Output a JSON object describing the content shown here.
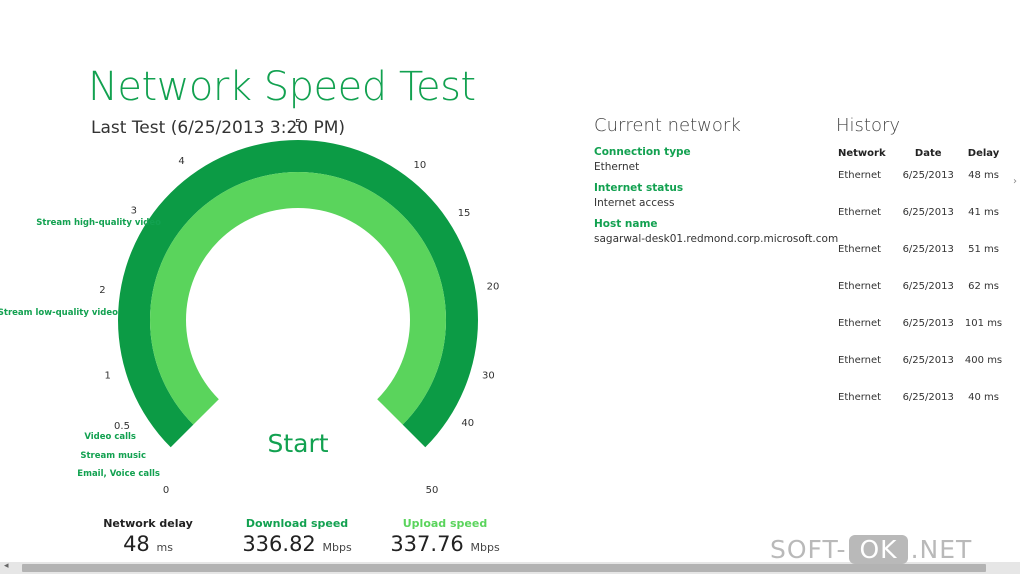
{
  "app": {
    "title": "Network Speed Test",
    "last_test": "Last Test (6/25/2013 3:20 PM)"
  },
  "gauge": {
    "start_label": "Start",
    "ticks": [
      "0",
      "0.5",
      "1",
      "2",
      "3",
      "4",
      "5",
      "10",
      "15",
      "20",
      "30",
      "40",
      "50"
    ],
    "use_labels": [
      "Stream high-quality video",
      "Stream low-quality video",
      "Video calls",
      "Stream music",
      "Email, Voice calls"
    ],
    "colors": {
      "outer": "#0c9b45",
      "inner": "#5ad45c",
      "accent": "#12a150"
    }
  },
  "metrics": [
    {
      "label": "Network delay",
      "value": "48",
      "unit": "ms",
      "color": "#222222"
    },
    {
      "label": "Download speed",
      "value": "336.82",
      "unit": "Mbps",
      "color": "#12a150"
    },
    {
      "label": "Upload speed",
      "value": "337.76",
      "unit": "Mbps",
      "color": "#5ad45c"
    }
  ],
  "current_network": {
    "title": "Current network",
    "items": [
      {
        "label": "Connection type",
        "value": "Ethernet"
      },
      {
        "label": "Internet status",
        "value": "Internet access"
      },
      {
        "label": "Host name",
        "value": "sagarwal-desk01.redmond.corp.microsoft.com"
      }
    ]
  },
  "history": {
    "title": "History",
    "columns": [
      "Network",
      "Date",
      "Delay"
    ],
    "rows": [
      [
        "Ethernet",
        "6/25/2013",
        "48 ms"
      ],
      [
        "Ethernet",
        "6/25/2013",
        "41 ms"
      ],
      [
        "Ethernet",
        "6/25/2013",
        "51 ms"
      ],
      [
        "Ethernet",
        "6/25/2013",
        "62 ms"
      ],
      [
        "Ethernet",
        "6/25/2013",
        "101 ms"
      ],
      [
        "Ethernet",
        "6/25/2013",
        "400 ms"
      ],
      [
        "Ethernet",
        "6/25/2013",
        "40 ms"
      ]
    ]
  },
  "watermark": {
    "pre": "SOFT-",
    "ok": "OK",
    "post": ".NET"
  }
}
